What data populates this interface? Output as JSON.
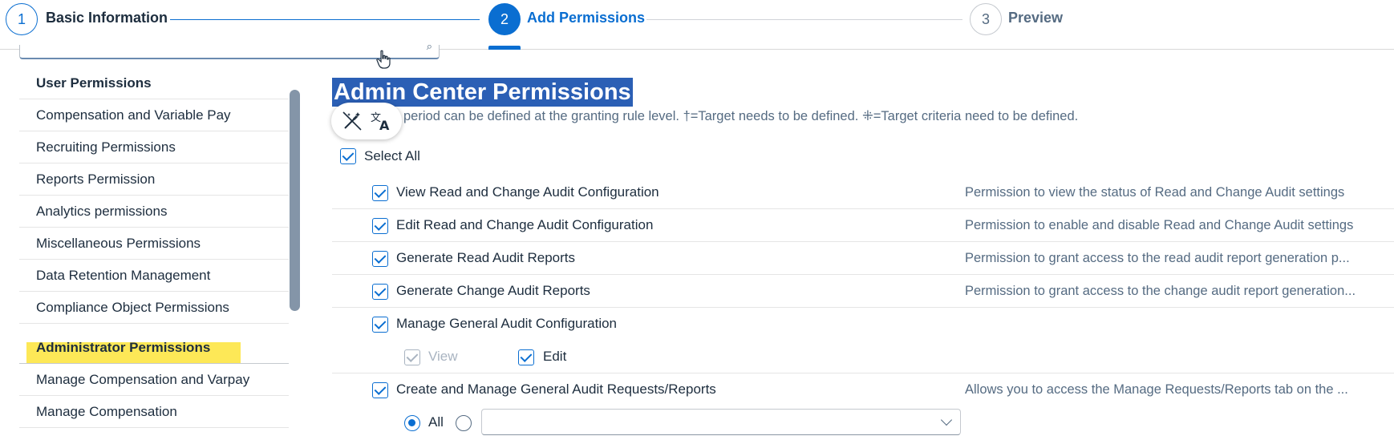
{
  "wizard": {
    "steps": [
      {
        "number": "1",
        "label": "Basic Information",
        "state": "done"
      },
      {
        "number": "2",
        "label": "Add Permissions",
        "state": "active"
      },
      {
        "number": "3",
        "label": "Preview",
        "state": "pending"
      }
    ]
  },
  "sidebar": {
    "items": [
      {
        "label": "User Permissions",
        "header": true
      },
      {
        "label": "Compensation and Variable Pay"
      },
      {
        "label": "Recruiting Permissions"
      },
      {
        "label": "Reports Permission"
      },
      {
        "label": "Analytics permissions"
      },
      {
        "label": "Miscellaneous Permissions"
      },
      {
        "label": "Data Retention Management"
      },
      {
        "label": "Compliance Object Permissions"
      }
    ],
    "admin_header": "Administrator Permissions",
    "admin_items": [
      {
        "label": "Manage Compensation and Varpay"
      },
      {
        "label": "Manage Compensation"
      }
    ]
  },
  "main": {
    "title": "Admin Center Permissions",
    "legend": "period can be defined at the granting rule level.   †=Target needs to be defined.   ⁜=Target criteria need to be defined.",
    "select_all": "Select All",
    "permissions": [
      {
        "label": "View Read and Change Audit Configuration",
        "desc": "Permission to view the status of Read and Change Audit settings"
      },
      {
        "label": "Edit Read and Change Audit Configuration",
        "desc": "Permission to enable and disable Read and Change Audit settings"
      },
      {
        "label": "Generate Read Audit Reports",
        "desc": "Permission to grant access to the read audit report generation p..."
      },
      {
        "label": "Generate Change Audit Reports",
        "desc": "Permission to grant access to the change audit report generation..."
      },
      {
        "label": "Manage General Audit Configuration",
        "desc": ""
      },
      {
        "label": "Create and Manage General Audit Requests/Reports",
        "desc": "Allows you to access the Manage Requests/Reports tab on the ..."
      }
    ],
    "sub_options": {
      "view": "View",
      "edit": "Edit"
    },
    "target": {
      "all_label": "All",
      "dropdown_value": ""
    }
  },
  "icons": {
    "toolbar": [
      "magic-wand-icon",
      "translate-icon"
    ],
    "search": "search-icon"
  }
}
